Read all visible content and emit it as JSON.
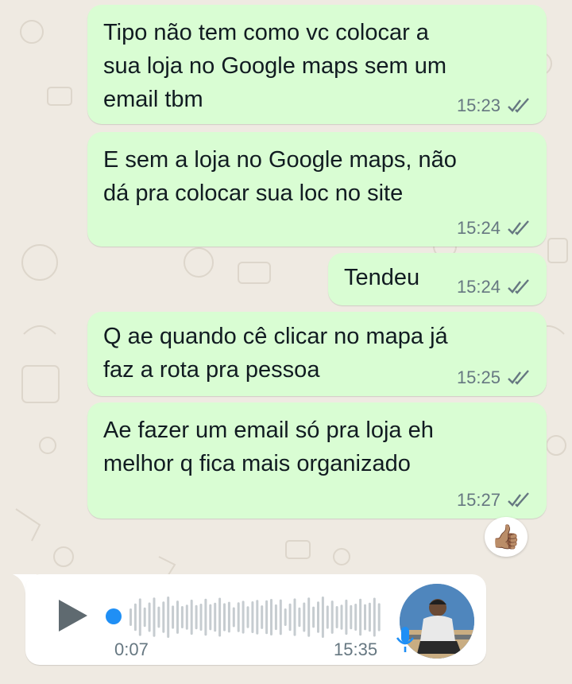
{
  "messages": [
    {
      "text": "Tipo não tem como vc colocar a\nsua loja no Google maps sem um\nemail tbm",
      "time": "15:23"
    },
    {
      "text": "E sem a loja no Google maps, não\ndá pra colocar sua loc no site",
      "time": "15:24"
    },
    {
      "text": "Tendeu",
      "time": "15:24"
    },
    {
      "text": "Q ae quando cê clicar no mapa já\nfaz a rota pra pessoa",
      "time": "15:25"
    },
    {
      "text": "Ae fazer um email só pra loja eh\nmelhor q fica mais organizado",
      "time": "15:27"
    }
  ],
  "reaction": {
    "emoji": "👍🏽"
  },
  "voice_message": {
    "duration": "0:07",
    "time": "15:35",
    "progress": 0,
    "icons": [
      "play-icon",
      "microphone-icon"
    ]
  },
  "colors": {
    "outgoing_bubble": "#d9fdd3",
    "incoming_bubble": "#ffffff",
    "chat_background": "#efeae2",
    "tick_color": "#667781",
    "progress_dot": "#1f8ff5"
  }
}
